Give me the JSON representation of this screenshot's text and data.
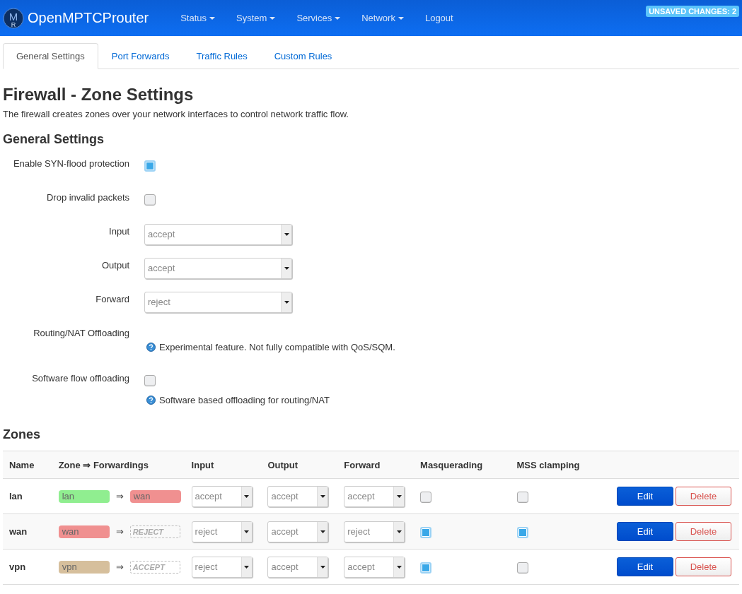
{
  "header": {
    "logo": {
      "letters": [
        "M",
        "R"
      ]
    },
    "brand": "OpenMPTCProuter",
    "menus": [
      {
        "label": "Status",
        "dropdown": true
      },
      {
        "label": "System",
        "dropdown": true
      },
      {
        "label": "Services",
        "dropdown": true
      },
      {
        "label": "Network",
        "dropdown": true
      },
      {
        "label": "Logout",
        "dropdown": false
      }
    ],
    "badge": "UNSAVED CHANGES: 2"
  },
  "tabs": [
    {
      "label": "General Settings",
      "selected": true
    },
    {
      "label": "Port Forwards",
      "selected": false
    },
    {
      "label": "Traffic Rules",
      "selected": false
    },
    {
      "label": "Custom Rules",
      "selected": false
    }
  ],
  "title": "Firewall - Zone Settings",
  "description": "The firewall creates zones over your network interfaces to control network traffic flow.",
  "general": {
    "heading": "General Settings",
    "fields": [
      {
        "kind": "checkbox",
        "label": "Enable SYN-flood protection",
        "checked": true
      },
      {
        "kind": "checkbox",
        "label": "Drop invalid packets",
        "checked": false
      },
      {
        "kind": "select",
        "label": "Input",
        "value": "accept"
      },
      {
        "kind": "select",
        "label": "Output",
        "value": "accept"
      },
      {
        "kind": "select",
        "label": "Forward",
        "value": "reject"
      },
      {
        "kind": "info",
        "label": "Routing/NAT Offloading",
        "note": "Experimental feature. Not fully compatible with QoS/SQM."
      },
      {
        "kind": "checkbox",
        "label": "Software flow offloading",
        "checked": false,
        "note": "Software based offloading for routing/NAT"
      }
    ]
  },
  "zones": {
    "heading": "Zones",
    "columns": [
      "Name",
      "Zone ⇒ Forwardings",
      "Input",
      "Output",
      "Forward",
      "Masquerading",
      "MSS clamping"
    ],
    "rows": [
      {
        "name": "lan",
        "zone": {
          "label": "lan",
          "color": "#90ee90"
        },
        "arrow": "⇒",
        "target": {
          "kind": "zone",
          "label": "wan",
          "color": "#f09090"
        },
        "input": "accept",
        "output": "accept",
        "forward": "accept",
        "masquerading": false,
        "mss_clamping": false,
        "edit": "Edit",
        "delete": "Delete"
      },
      {
        "name": "wan",
        "zone": {
          "label": "wan",
          "color": "#f09090"
        },
        "arrow": "⇒",
        "target": {
          "kind": "policy",
          "label": "REJECT"
        },
        "input": "reject",
        "output": "accept",
        "forward": "reject",
        "masquerading": true,
        "mss_clamping": true,
        "edit": "Edit",
        "delete": "Delete"
      },
      {
        "name": "vpn",
        "zone": {
          "label": "vpn",
          "color": "#d6bf9c"
        },
        "arrow": "⇒",
        "target": {
          "kind": "policy",
          "label": "ACCEPT"
        },
        "input": "reject",
        "output": "accept",
        "forward": "accept",
        "masquerading": true,
        "mss_clamping": false,
        "edit": "Edit",
        "delete": "Delete"
      }
    ]
  }
}
